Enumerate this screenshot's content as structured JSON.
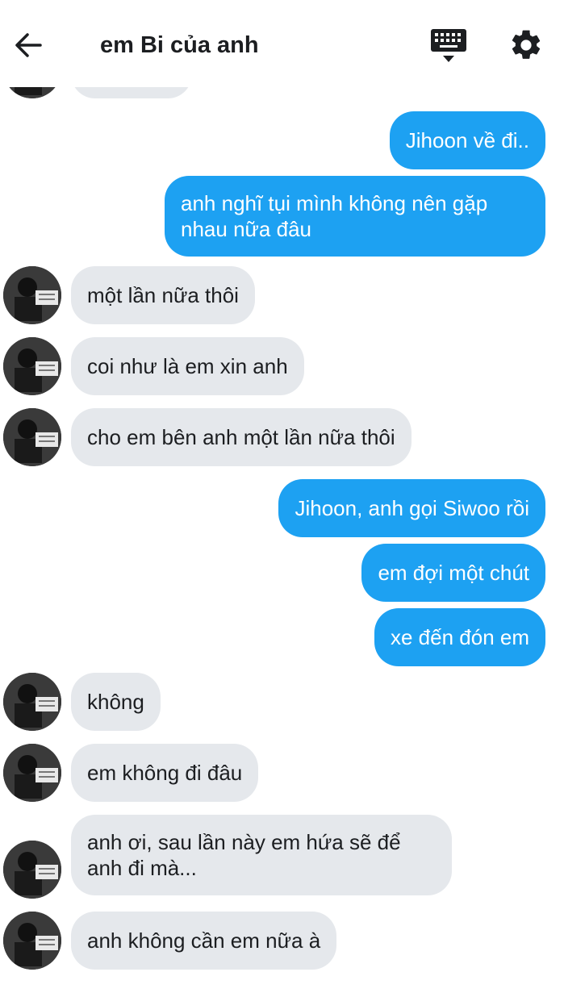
{
  "header": {
    "title": "em Bi của anh",
    "back_icon": "arrow-left-icon",
    "keyboard_icon": "keyboard-icon",
    "settings_icon": "gear-icon"
  },
  "colors": {
    "outgoing_bubble": "#1da1f2",
    "incoming_bubble": "#e5e8ec",
    "text": "#1c1e21"
  },
  "messages": [
    {
      "side": "in",
      "text": ""
    },
    {
      "side": "out",
      "text": "Jihoon về đi.."
    },
    {
      "side": "out",
      "text": "anh nghĩ tụi mình không nên gặp nhau nữa đâu"
    },
    {
      "side": "in",
      "text": "một lần nữa thôi"
    },
    {
      "side": "in",
      "text": "coi như là em xin anh"
    },
    {
      "side": "in",
      "text": "cho em bên anh một lần nữa thôi"
    },
    {
      "side": "out",
      "text": "Jihoon, anh gọi Siwoo rồi"
    },
    {
      "side": "out",
      "text": "em đợi một chút"
    },
    {
      "side": "out",
      "text": "xe đến đón em"
    },
    {
      "side": "in",
      "text": "không"
    },
    {
      "side": "in",
      "text": "em không đi đâu"
    },
    {
      "side": "in",
      "text": "anh ơi, sau lần này em hứa sẽ để anh đi mà..."
    },
    {
      "side": "in",
      "text": "anh không cần em nữa à"
    }
  ]
}
